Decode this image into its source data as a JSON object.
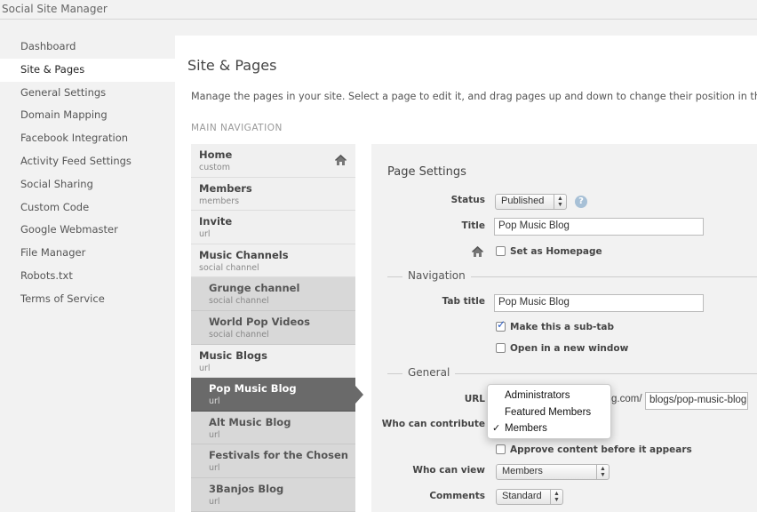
{
  "app": {
    "title": "Social Site Manager"
  },
  "sidebar": {
    "items": [
      {
        "label": "Dashboard",
        "active": false
      },
      {
        "label": "Site & Pages",
        "active": true
      },
      {
        "label": "General Settings",
        "active": false
      },
      {
        "label": "Domain Mapping",
        "active": false
      },
      {
        "label": "Facebook Integration",
        "active": false
      },
      {
        "label": "Activity Feed Settings",
        "active": false
      },
      {
        "label": "Social Sharing",
        "active": false
      },
      {
        "label": "Custom Code",
        "active": false
      },
      {
        "label": "Google Webmaster",
        "active": false
      },
      {
        "label": "File Manager",
        "active": false
      },
      {
        "label": "Robots.txt",
        "active": false
      },
      {
        "label": "Terms of Service",
        "active": false
      }
    ]
  },
  "main": {
    "title": "Site & Pages",
    "description": "Manage the pages in your site. Select a page to edit it, and drag pages up and down to change their position in the nav",
    "section_label": "MAIN NAVIGATION"
  },
  "pages": [
    {
      "name": "Home",
      "type": "custom",
      "child": false,
      "selected": false,
      "icon": "home-icon"
    },
    {
      "name": "Members",
      "type": "members",
      "child": false,
      "selected": false
    },
    {
      "name": "Invite",
      "type": "url",
      "child": false,
      "selected": false
    },
    {
      "name": "Music Channels",
      "type": "social channel",
      "child": false,
      "selected": false
    },
    {
      "name": "Grunge channel",
      "type": "social channel",
      "child": true,
      "selected": false
    },
    {
      "name": "World Pop Videos",
      "type": "social channel",
      "child": true,
      "selected": false
    },
    {
      "name": "Music Blogs",
      "type": "url",
      "child": false,
      "selected": false
    },
    {
      "name": "Pop Music Blog",
      "type": "url",
      "child": true,
      "selected": true
    },
    {
      "name": "Alt Music Blog",
      "type": "url",
      "child": true,
      "selected": false
    },
    {
      "name": "Festivals for the Chosen",
      "type": "url",
      "child": true,
      "selected": false
    },
    {
      "name": "3Banjos Blog",
      "type": "url",
      "child": true,
      "selected": false
    }
  ],
  "settings": {
    "title": "Page Settings",
    "status_label": "Status",
    "status_value": "Published",
    "help_glyph": "?",
    "title_label": "Title",
    "title_value": "Pop Music Blog",
    "homepage_label": "Set as Homepage",
    "navigation_legend": "Navigation",
    "tab_title_label": "Tab title",
    "tab_title_value": "Pop Music Blog",
    "subtab_label": "Make this a sub-tab",
    "subtab_checked": true,
    "new_window_label": "Open in a new window",
    "general_legend": "General",
    "url_label": "URL",
    "url_domain_suffix": "g.com/",
    "url_value": "blogs/pop-music-blog",
    "contribute_label": "Who can contribute",
    "approve_label": "Approve content before it appears",
    "view_label": "Who can view",
    "view_value": "Members",
    "comments_label": "Comments",
    "comments_value": "Standard"
  },
  "contribute_dropdown": {
    "options": [
      {
        "label": "Administrators",
        "selected": false
      },
      {
        "label": "Featured Members",
        "selected": false
      },
      {
        "label": "Members",
        "selected": true
      }
    ],
    "check_glyph": "✓"
  },
  "colors": {
    "selected_page": "#6a6a6a",
    "child_page": "#d8d8d8",
    "help_icon": "#a7c0d6",
    "check": "#2a5cc4"
  }
}
